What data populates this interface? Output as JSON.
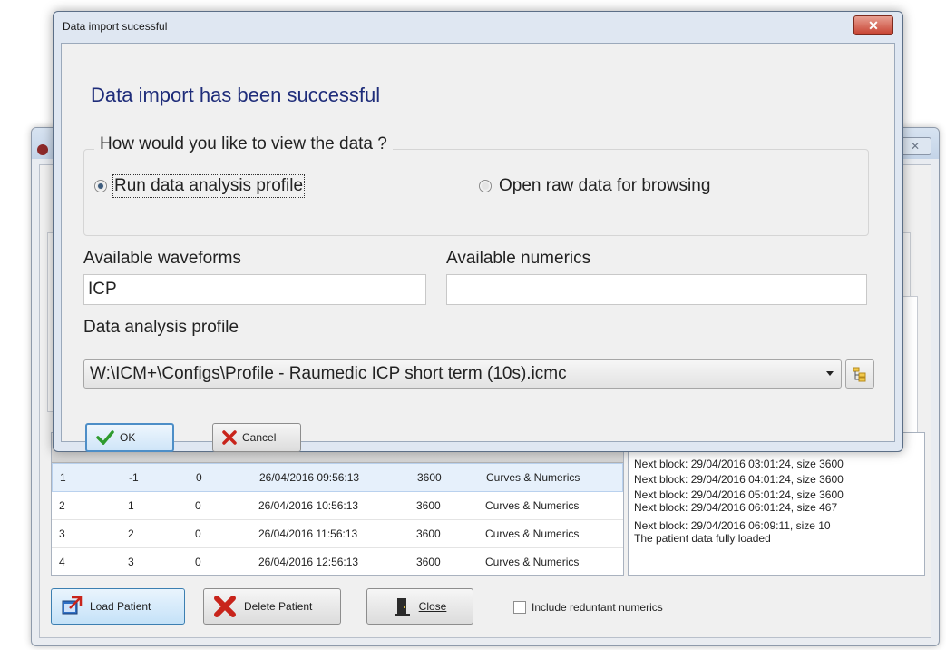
{
  "dialog": {
    "title": "Data import sucessful",
    "close_glyph": "✕",
    "heading": "Data import has been successful",
    "view_group": {
      "legend": "How would you like to view the data ?",
      "options": [
        {
          "label": "Run data analysis profile",
          "selected": true
        },
        {
          "label": "Open raw data for browsing",
          "selected": false
        }
      ]
    },
    "waveforms": {
      "label": "Available waveforms",
      "value": "ICP"
    },
    "numerics": {
      "label": "Available numerics",
      "value": ""
    },
    "profile": {
      "label": "Data analysis profile",
      "value": "W:\\ICM+\\Configs\\Profile - Raumedic ICP short term (10s).icmc"
    },
    "buttons": {
      "ok": "OK",
      "cancel": "Cancel"
    }
  },
  "patients_table": {
    "rows": [
      [
        "1",
        "-1",
        "0",
        "26/04/2016 09:56:13",
        "3600",
        "Curves & Numerics"
      ],
      [
        "2",
        "1",
        "0",
        "26/04/2016 10:56:13",
        "3600",
        "Curves & Numerics"
      ],
      [
        "3",
        "2",
        "0",
        "26/04/2016 11:56:13",
        "3600",
        "Curves & Numerics"
      ],
      [
        "4",
        "3",
        "0",
        "26/04/2016 12:56:13",
        "3600",
        "Curves & Numerics"
      ]
    ]
  },
  "log": {
    "lines": [
      "Next block: 29/04/2016 03:01:24, size 3600",
      "Next block: 29/04/2016 04:01:24, size 3600",
      "Next block: 29/04/2016 05:01:24, size 3600",
      "Next block: 29/04/2016 06:01:24, size 467",
      "Next block: 29/04/2016 06:09:11, size 10",
      "The patient data fully loaded"
    ]
  },
  "bottom_bar": {
    "load_patient": "Load Patient",
    "delete_patient": "Delete Patient",
    "close": "Close",
    "include_redundant": "Include reduntant numerics"
  },
  "colors": {
    "heading": "#1f2d7a",
    "accent": "#3c7fb1",
    "close_red": "#c74231",
    "ok_green": "#2e9b2e",
    "cancel_red": "#c8241b"
  }
}
